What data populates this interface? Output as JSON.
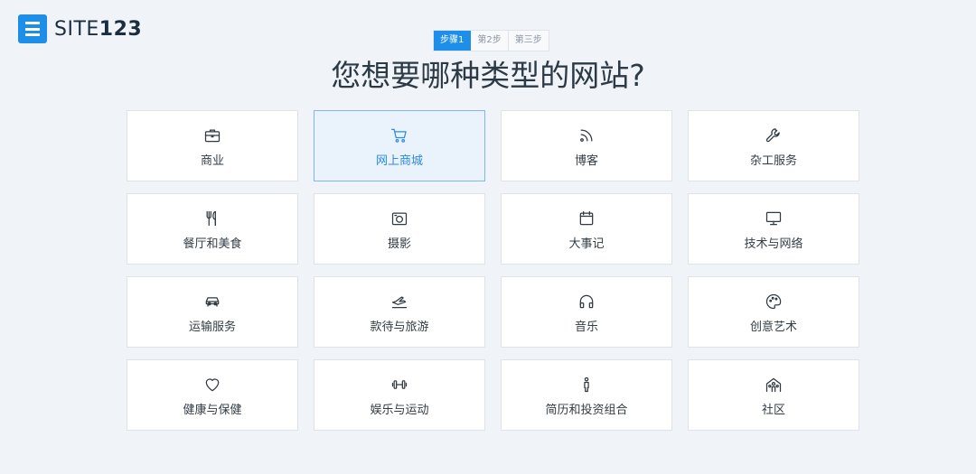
{
  "brand": {
    "name_light": "SITE",
    "name_bold": "123",
    "color": "#1e8fe8"
  },
  "steps": [
    {
      "label": "步骤1",
      "active": true
    },
    {
      "label": "第2步",
      "active": false
    },
    {
      "label": "第三步",
      "active": false
    }
  ],
  "heading": "您想要哪种类型的网站?",
  "categories": [
    {
      "label": "商业",
      "icon": "briefcase-icon"
    },
    {
      "label": "网上商城",
      "icon": "shopping-cart-icon",
      "selected": true
    },
    {
      "label": "博客",
      "icon": "rss-icon"
    },
    {
      "label": "杂工服务",
      "icon": "wrench-icon"
    },
    {
      "label": "餐厅和美食",
      "icon": "utensils-icon"
    },
    {
      "label": "摄影",
      "icon": "camera-icon"
    },
    {
      "label": "大事记",
      "icon": "calendar-icon"
    },
    {
      "label": "技术与网络",
      "icon": "monitor-icon"
    },
    {
      "label": "运输服务",
      "icon": "car-icon"
    },
    {
      "label": "款待与旅游",
      "icon": "plane-icon"
    },
    {
      "label": "音乐",
      "icon": "headphones-icon"
    },
    {
      "label": "创意艺术",
      "icon": "palette-icon"
    },
    {
      "label": "健康与保健",
      "icon": "heart-icon"
    },
    {
      "label": "娱乐与运动",
      "icon": "dumbbell-icon"
    },
    {
      "label": "简历和投资组合",
      "icon": "person-icon"
    },
    {
      "label": "社区",
      "icon": "community-icon"
    }
  ]
}
